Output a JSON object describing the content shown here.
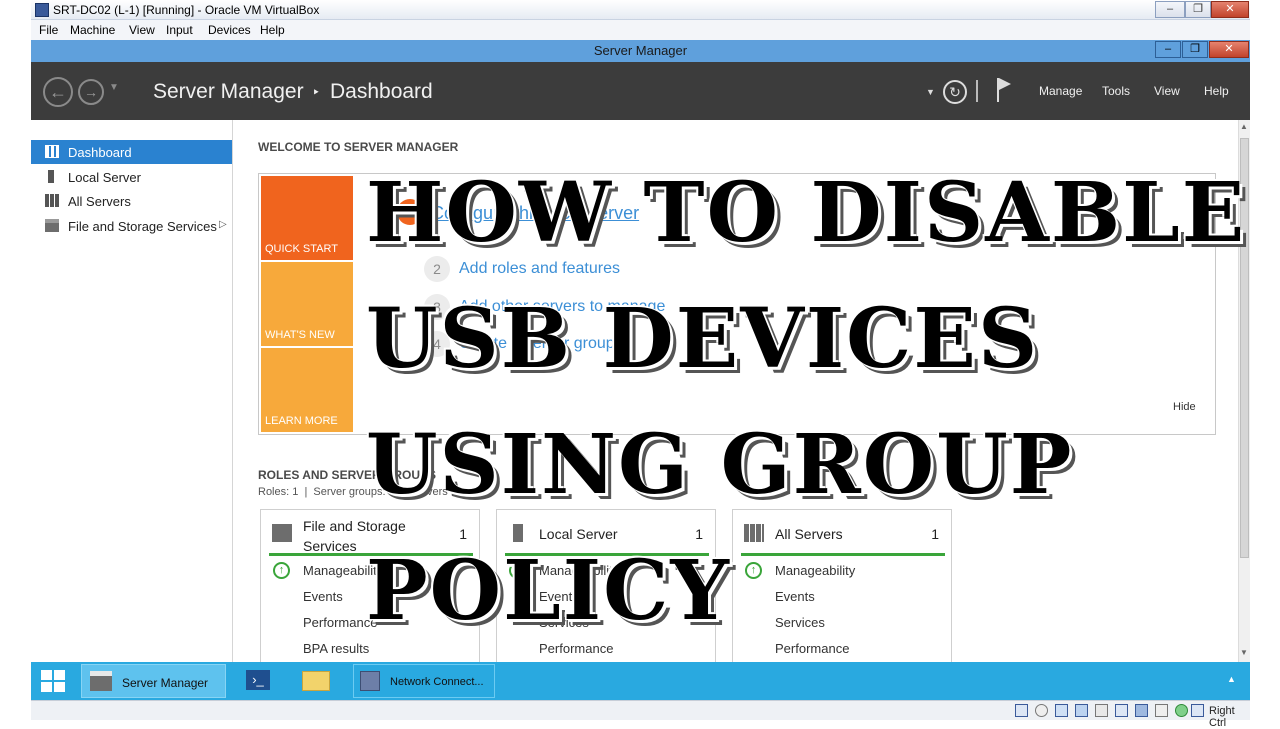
{
  "vbox": {
    "title": "SRT-DC02 (L-1) [Running] - Oracle VM VirtualBox",
    "menu": [
      "File",
      "Machine",
      "View",
      "Input",
      "Devices",
      "Help"
    ],
    "status_right": "Right Ctrl"
  },
  "sm": {
    "window_title": "Server Manager",
    "breadcrumb": {
      "root": "Server Manager",
      "separator": "‣",
      "current": "Dashboard"
    },
    "menu": [
      "Manage",
      "Tools",
      "View",
      "Help"
    ]
  },
  "sidebar": {
    "items": [
      {
        "label": "Dashboard",
        "active": true
      },
      {
        "label": "Local Server"
      },
      {
        "label": "All Servers"
      },
      {
        "label": "File and Storage Services",
        "arrow": "▷"
      }
    ]
  },
  "welcome": {
    "heading": "WELCOME TO SERVER MANAGER",
    "tiles": [
      "QUICK START",
      "WHAT'S NEW",
      "LEARN MORE"
    ],
    "steps": [
      {
        "num": "1",
        "label": "Configure this local server"
      },
      {
        "num": "2",
        "label": "Add roles and features"
      },
      {
        "num": "3",
        "label": "Add other servers to manage"
      },
      {
        "num": "4",
        "label": "Create a server group"
      }
    ],
    "hide": "Hide"
  },
  "roles": {
    "heading": "ROLES AND SERVER GROUPS",
    "summary": "Roles: 1  |  Server groups: 1  |  Servers total: 1",
    "cards": [
      {
        "title": "File and Storage Services",
        "count": "1",
        "rows": [
          "Manageability",
          "Events",
          "Performance",
          "BPA results"
        ]
      },
      {
        "title": "Local Server",
        "count": "1",
        "rows": [
          "Manageability",
          "Events",
          "Services",
          "Performance"
        ]
      },
      {
        "title": "All Servers",
        "count": "1",
        "rows": [
          "Manageability",
          "Events",
          "Services",
          "Performance"
        ]
      }
    ]
  },
  "taskbar": {
    "items": [
      "Server Manager",
      "Network Connect..."
    ]
  },
  "overlay": {
    "lines": [
      "HOW TO DISABLE",
      "USB DEVICES",
      "USING GROUP",
      "POLICY"
    ]
  },
  "colors": {
    "accent": "#2a82d0",
    "header": "#3c3c3c",
    "quick_start_tile": "#f0641e",
    "tile": "#f7a93b",
    "taskbar": "#29a9e0",
    "status_green": "#3aa53a"
  }
}
